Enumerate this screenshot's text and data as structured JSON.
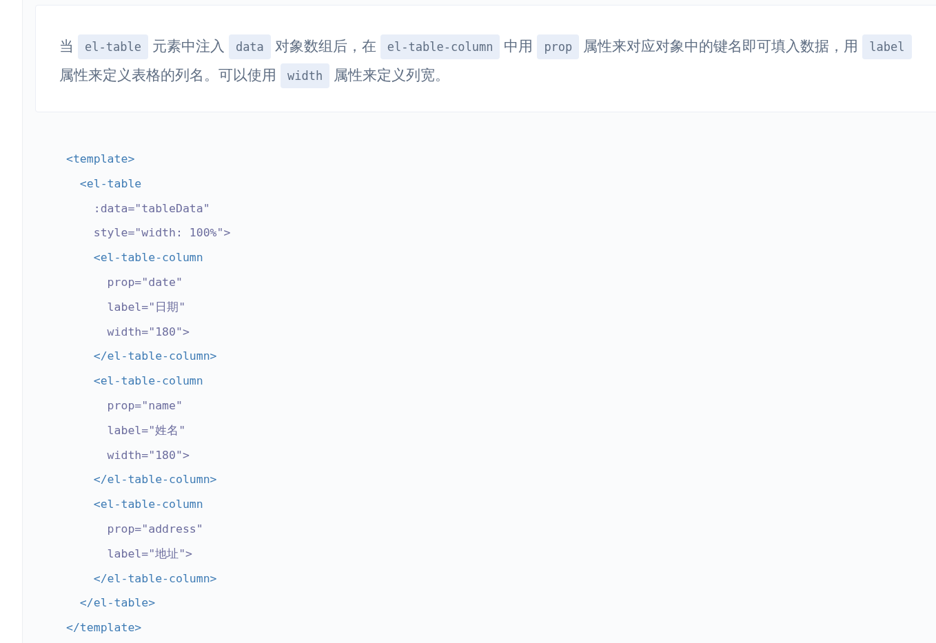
{
  "description": [
    {
      "kind": "text",
      "text": "当"
    },
    {
      "kind": "code",
      "text": "el-table"
    },
    {
      "kind": "text",
      "text": "元素中注入"
    },
    {
      "kind": "code",
      "text": "data"
    },
    {
      "kind": "text",
      "text": "对象数组后，在"
    },
    {
      "kind": "code",
      "text": "el-table-column"
    },
    {
      "kind": "text",
      "text": "中用"
    },
    {
      "kind": "code",
      "text": "prop"
    },
    {
      "kind": "text",
      "text": "属性来对应对象中的键名即可填入数据，用"
    },
    {
      "kind": "code",
      "text": "label"
    },
    {
      "kind": "text",
      "text": "属性来定义表格的列名。可以使用"
    },
    {
      "kind": "code",
      "text": "width"
    },
    {
      "kind": "text",
      "text": "属性来定义列宽。"
    }
  ],
  "code_lines": [
    {
      "kind": "tag",
      "text": "<template>"
    },
    {
      "kind": "tag",
      "text": "  <el-table"
    },
    {
      "kind": "attr",
      "text": "    :data=\"tableData\""
    },
    {
      "kind": "attr",
      "text": "    style=\"width: 100%\">"
    },
    {
      "kind": "tag",
      "text": "    <el-table-column"
    },
    {
      "kind": "attr",
      "text": "      prop=\"date\""
    },
    {
      "kind": "attr",
      "text": "      label=\"日期\""
    },
    {
      "kind": "attr",
      "text": "      width=\"180\">"
    },
    {
      "kind": "tag",
      "text": "    </el-table-column>"
    },
    {
      "kind": "tag",
      "text": "    <el-table-column"
    },
    {
      "kind": "attr",
      "text": "      prop=\"name\""
    },
    {
      "kind": "attr",
      "text": "      label=\"姓名\""
    },
    {
      "kind": "attr",
      "text": "      width=\"180\">"
    },
    {
      "kind": "tag",
      "text": "    </el-table-column>"
    },
    {
      "kind": "tag",
      "text": "    <el-table-column"
    },
    {
      "kind": "attr",
      "text": "      prop=\"address\""
    },
    {
      "kind": "attr",
      "text": "      label=\"地址\">"
    },
    {
      "kind": "tag",
      "text": "    </el-table-column>"
    },
    {
      "kind": "tag",
      "text": "  </el-table>"
    },
    {
      "kind": "tag",
      "text": "</template>"
    }
  ]
}
